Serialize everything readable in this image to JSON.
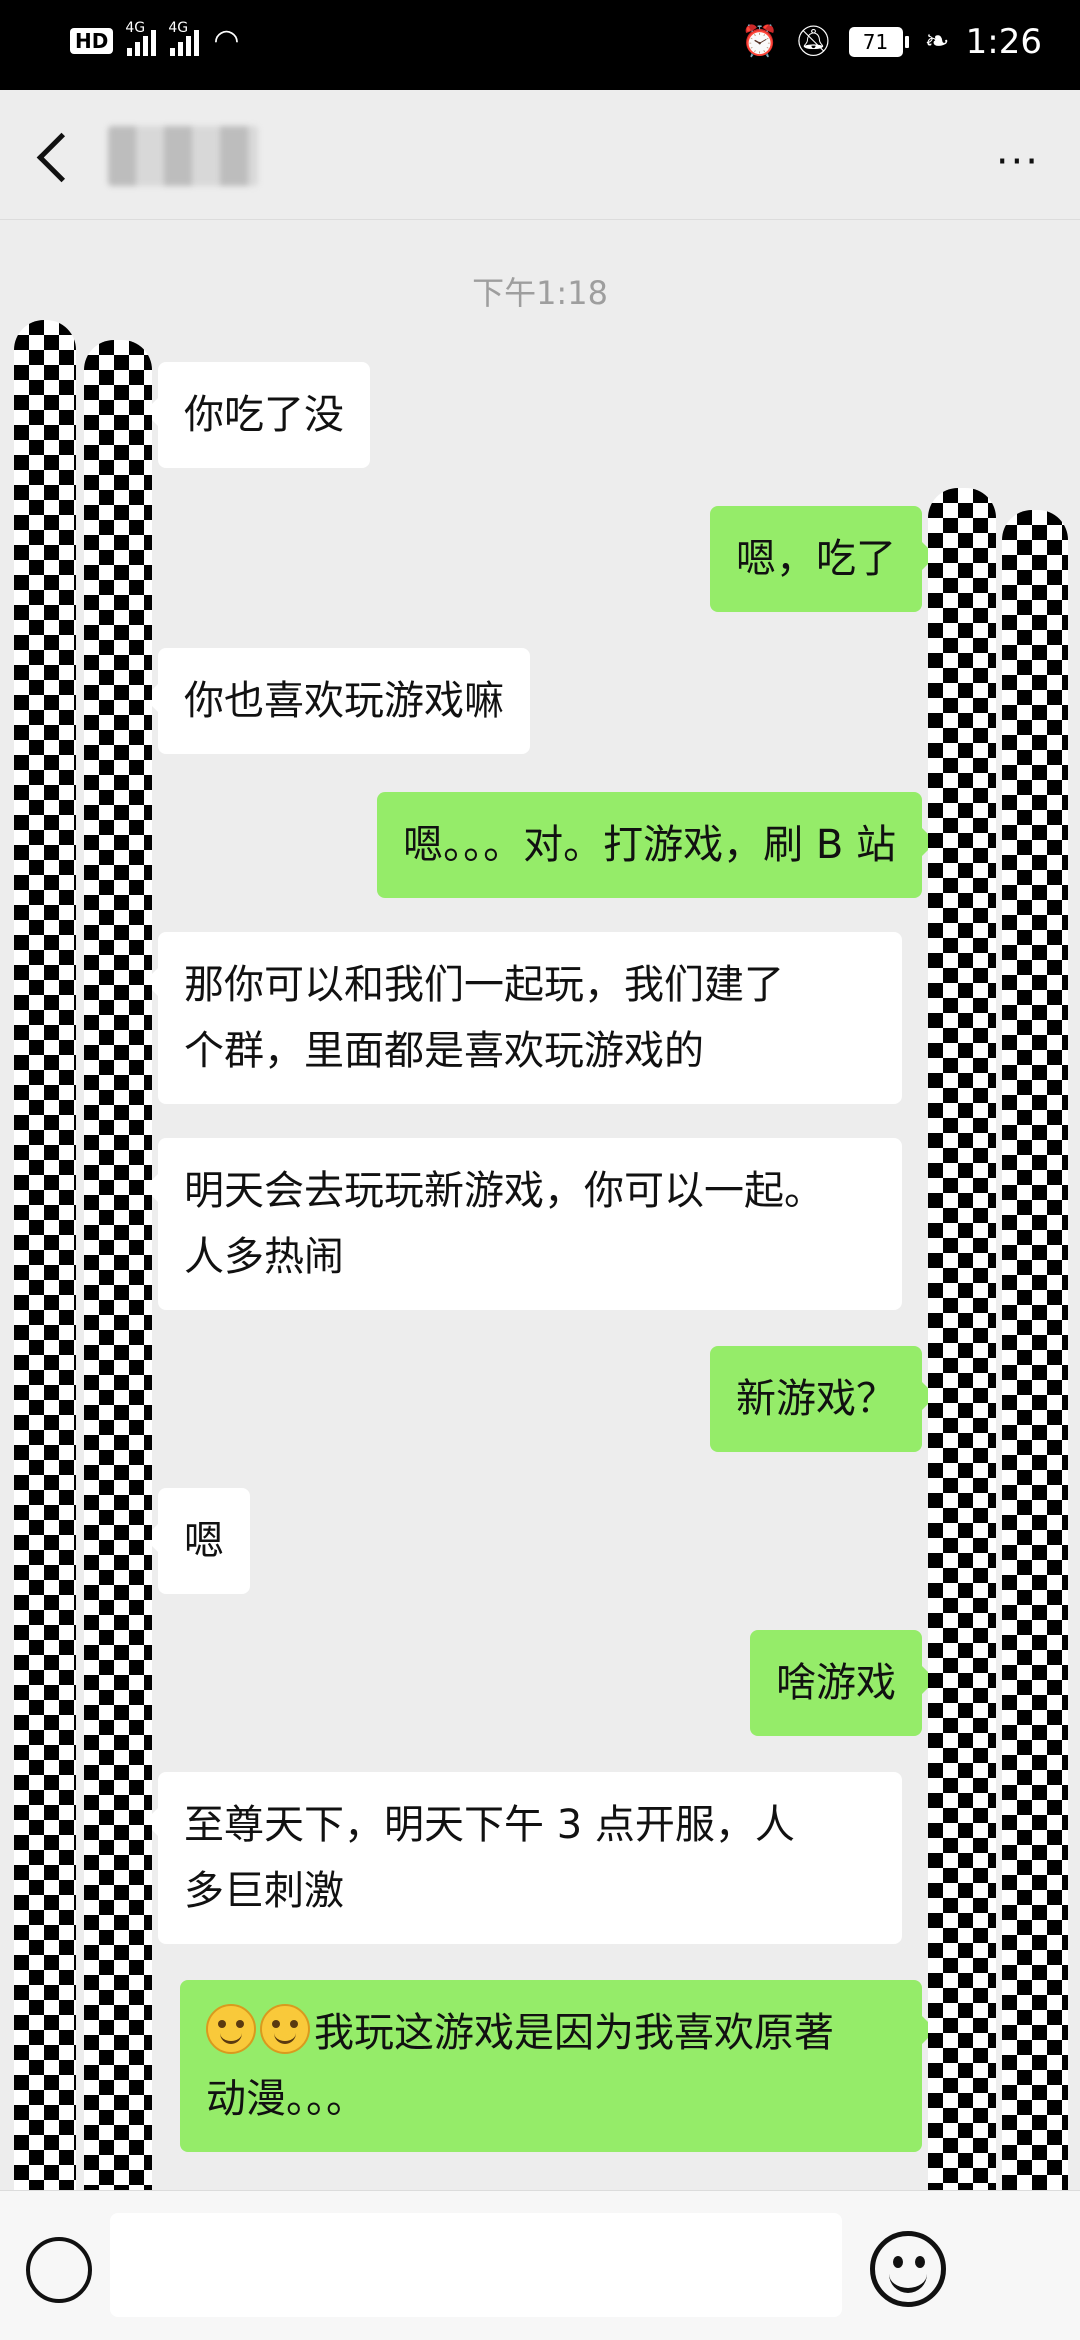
{
  "status_bar": {
    "hd": "HD",
    "network_1": "4G",
    "network_2": "4G",
    "battery": "71",
    "time": "1:26",
    "icons": [
      "wifi-icon",
      "alarm-icon",
      "mute-icon",
      "leaf-icon"
    ]
  },
  "header": {
    "back_icon": "chevron-left-icon",
    "more_label": "···"
  },
  "chat": {
    "timestamp": "下午1:18",
    "messages": [
      {
        "side": "in",
        "text": "你吃了没"
      },
      {
        "side": "out",
        "text": "嗯，吃了"
      },
      {
        "side": "in",
        "text": "你也喜欢玩游戏嘛"
      },
      {
        "side": "out",
        "text": "嗯。。。对。打游戏，刷 B 站"
      },
      {
        "side": "in",
        "line1": "那你可以和我们一起玩，我们建了",
        "line2": "个群，里面都是喜欢玩游戏的"
      },
      {
        "side": "in",
        "line1": "明天会去玩玩新游戏，你可以一起。",
        "line2": "人多热闹"
      },
      {
        "side": "out",
        "text": "新游戏？"
      },
      {
        "side": "in",
        "text": "嗯"
      },
      {
        "side": "out",
        "text": "啥游戏"
      },
      {
        "side": "in",
        "line1": "至尊天下，明天下午 3 点开服，人",
        "line2": "多巨刺激"
      },
      {
        "side": "out",
        "emoji": "smile-emoji",
        "line1": "我玩这游戏是因为我喜欢原著",
        "line2": "动漫。。。"
      }
    ]
  },
  "input_bar": {
    "value": "",
    "voice_icon": "voice-icon",
    "emoji_icon": "emoji-icon"
  },
  "colors": {
    "background": "#ededed",
    "bubble_in": "#ffffff",
    "bubble_out": "#95ec69",
    "status_bar": "#000000"
  }
}
